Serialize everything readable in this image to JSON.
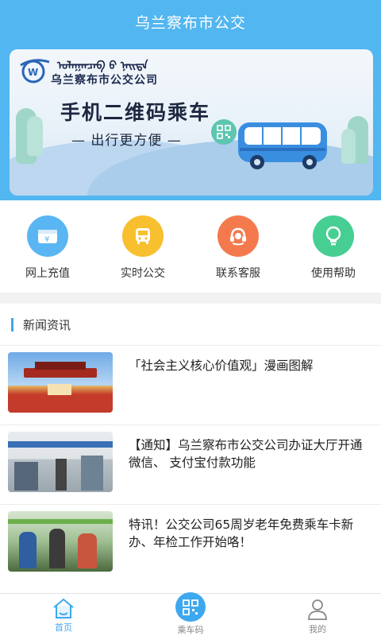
{
  "app": {
    "title": "乌兰察布市公交"
  },
  "banner": {
    "mongolian": "ᠣᠯᠠᠭᠠᠨᠴᠠᠪ ᠤ᠋ ᠨᠡᠢᠲᠡ",
    "company": "乌兰察布市公交公司",
    "headline": "手机二维码乘车",
    "subline": "— 出行更方便 —"
  },
  "quick_actions": [
    {
      "label": "网上充值",
      "icon": "wallet-icon",
      "color": "#5ab6f3"
    },
    {
      "label": "实时公交",
      "icon": "bus-icon",
      "color": "#f8bf2f"
    },
    {
      "label": "联系客服",
      "icon": "headset-icon",
      "color": "#f47a4e"
    },
    {
      "label": "使用帮助",
      "icon": "lightbulb-icon",
      "color": "#46ce93"
    }
  ],
  "news": {
    "title": "新闻资讯",
    "items": [
      {
        "text": "「社会主义核心价值观」漫画图解",
        "thumb": "tiananmen-photo"
      },
      {
        "text": "【通知】乌兰察布市公交公司办证大厅开通微信、 支付宝付款功能",
        "thumb": "service-hall-photo"
      },
      {
        "text": "特讯！公交公司65周岁老年免费乘车卡新办、年检工作开始咯！",
        "thumb": "bus-interior-photo"
      }
    ]
  },
  "tabbar": [
    {
      "label": "首页",
      "icon": "home-icon",
      "active": true
    },
    {
      "label": "乘车码",
      "icon": "qrcode-icon",
      "active": false
    },
    {
      "label": "我的",
      "icon": "user-icon",
      "active": false
    }
  ],
  "colors": {
    "primary": "#52b6f0",
    "accent": "#3ea8ee"
  }
}
